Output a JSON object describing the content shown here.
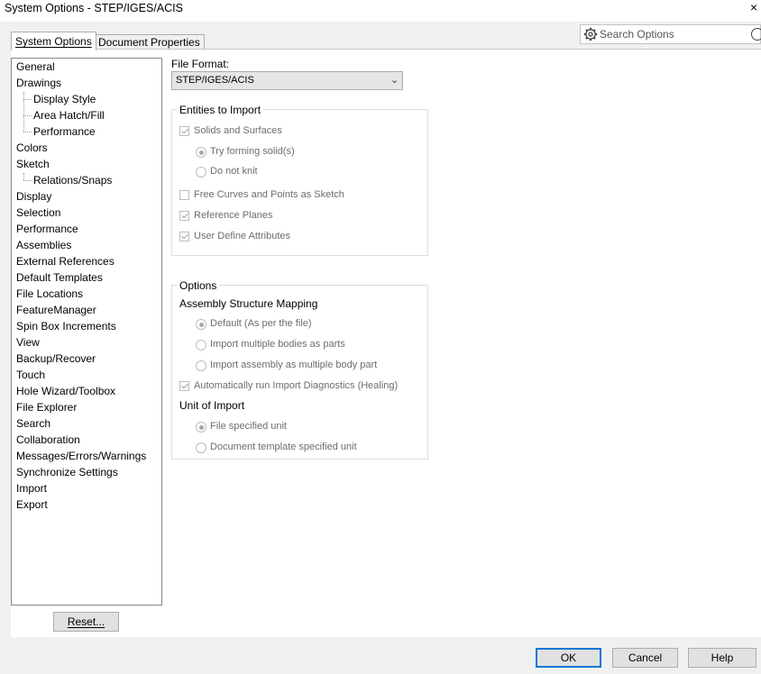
{
  "window": {
    "title": "System Options - STEP/IGES/ACIS",
    "close_glyph": "×"
  },
  "tabs": [
    {
      "label": "System Options",
      "active": true
    },
    {
      "label": "Document Properties",
      "active": false
    }
  ],
  "search": {
    "placeholder": "Search Options"
  },
  "tree": {
    "items": [
      {
        "label": "General",
        "level": 0
      },
      {
        "label": "Drawings",
        "level": 0
      },
      {
        "label": "Display Style",
        "level": 1
      },
      {
        "label": "Area Hatch/Fill",
        "level": 1
      },
      {
        "label": "Performance",
        "level": 1
      },
      {
        "label": "Colors",
        "level": 0
      },
      {
        "label": "Sketch",
        "level": 0
      },
      {
        "label": "Relations/Snaps",
        "level": 1
      },
      {
        "label": "Display",
        "level": 0
      },
      {
        "label": "Selection",
        "level": 0
      },
      {
        "label": "Performance",
        "level": 0
      },
      {
        "label": "Assemblies",
        "level": 0
      },
      {
        "label": "External References",
        "level": 0
      },
      {
        "label": "Default Templates",
        "level": 0
      },
      {
        "label": "File Locations",
        "level": 0
      },
      {
        "label": "FeatureManager",
        "level": 0
      },
      {
        "label": "Spin Box Increments",
        "level": 0
      },
      {
        "label": "View",
        "level": 0
      },
      {
        "label": "Backup/Recover",
        "level": 0
      },
      {
        "label": "Touch",
        "level": 0
      },
      {
        "label": "Hole Wizard/Toolbox",
        "level": 0
      },
      {
        "label": "File Explorer",
        "level": 0
      },
      {
        "label": "Search",
        "level": 0
      },
      {
        "label": "Collaboration",
        "level": 0
      },
      {
        "label": "Messages/Errors/Warnings",
        "level": 0
      },
      {
        "label": "Synchronize Settings",
        "level": 0
      },
      {
        "label": "Import",
        "level": 0
      },
      {
        "label": "Export",
        "level": 0
      }
    ]
  },
  "reset_button": "Reset...",
  "file_format": {
    "label": "File Format:",
    "value": "STEP/IGES/ACIS"
  },
  "entities": {
    "title": "Entities to Import",
    "solids": {
      "label": "Solids and Surfaces",
      "checked": true
    },
    "try_forming": {
      "label": "Try forming solid(s)",
      "selected": true
    },
    "do_not_knit": {
      "label": "Do not knit",
      "selected": false
    },
    "free_curves": {
      "label": "Free Curves and Points as Sketch",
      "checked": false
    },
    "ref_planes": {
      "label": "Reference Planes",
      "checked": true
    },
    "user_attrs": {
      "label": "User Define Attributes",
      "checked": true
    }
  },
  "options": {
    "title": "Options",
    "asm_mapping": "Assembly Structure Mapping",
    "default_file": {
      "label": "Default (As per the file)",
      "selected": true
    },
    "multi_bodies_parts": {
      "label": "Import multiple bodies as parts",
      "selected": false
    },
    "asm_multi_body": {
      "label": "Import assembly as multiple body part",
      "selected": false
    },
    "auto_diag": {
      "label": "Automatically run Import Diagnostics (Healing)",
      "checked": true
    },
    "unit_title": "Unit of Import",
    "file_unit": {
      "label": "File specified unit",
      "selected": true
    },
    "doc_template_unit": {
      "label": "Document template specified unit",
      "selected": false
    }
  },
  "footer": {
    "ok": "OK",
    "cancel": "Cancel",
    "help": "Help"
  }
}
